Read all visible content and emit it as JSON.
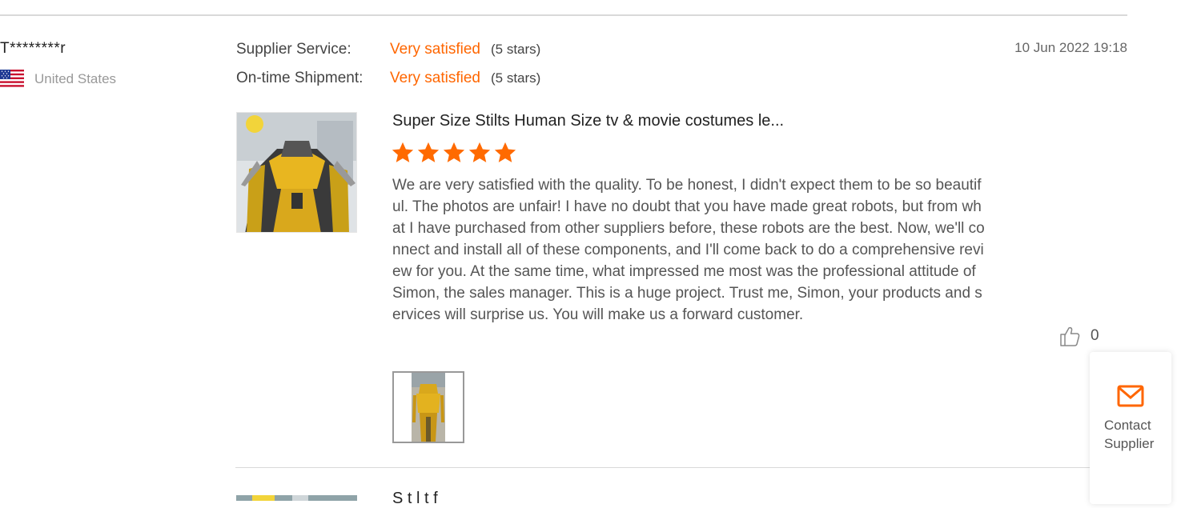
{
  "reviewer": {
    "name": "T********r",
    "country": "United States",
    "flag_icon": "us-flag-icon"
  },
  "ratings": [
    {
      "label": "Supplier Service:",
      "value": "Very satisfied",
      "stars_text": "(5 stars)"
    },
    {
      "label": "On-time Shipment:",
      "value": "Very satisfied",
      "stars_text": "(5 stars)"
    }
  ],
  "review": {
    "date": "10 Jun 2022 19:18",
    "product_title": "Super Size Stilts Human Size tv & movie costumes le...",
    "star_count": 5,
    "text": "We are very satisfied with the quality. To be honest, I didn't expect them to be so beautiful. The photos are unfair! I have no doubt that you have made great robots, but from what I have purchased from other suppliers before, these robots are the best. Now, we'll connect and install all of these components, and I'll come back to do a comprehensive review for you. At the same time, what impressed me most was the professional attitude of Simon, the sales manager. This is a huge project. Trust me, Simon, your products and services will surprise us. You will make us a forward customer.",
    "likes": "0",
    "like_icon": "thumbs-up-icon"
  },
  "contact": {
    "label": "Contact Supplier",
    "icon": "mail-icon"
  },
  "next_review": {
    "product_title_partial": "S             t         l                               t         f"
  },
  "colors": {
    "accent": "#ff6600",
    "divider": "#d9d9d9",
    "text_muted": "#999999"
  }
}
